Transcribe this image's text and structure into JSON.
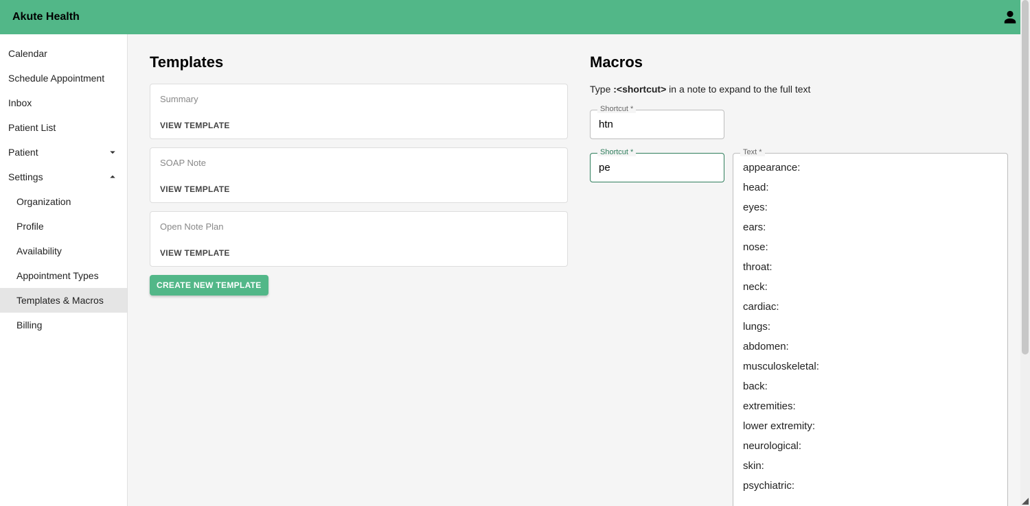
{
  "appbar": {
    "brand": "Akute Health"
  },
  "sidebar": {
    "items": [
      {
        "label": "Calendar",
        "expand": null
      },
      {
        "label": "Schedule Appointment",
        "expand": null
      },
      {
        "label": "Inbox",
        "expand": null
      },
      {
        "label": "Patient List",
        "expand": null
      },
      {
        "label": "Patient",
        "expand": "down"
      },
      {
        "label": "Settings",
        "expand": "up"
      }
    ],
    "settings_sub": [
      {
        "label": "Organization"
      },
      {
        "label": "Profile"
      },
      {
        "label": "Availability"
      },
      {
        "label": "Appointment Types"
      },
      {
        "label": "Templates & Macros",
        "active": true
      },
      {
        "label": "Billing"
      }
    ]
  },
  "templates": {
    "title": "Templates",
    "view_label": "VIEW TEMPLATE",
    "create_label": "CREATE NEW TEMPLATE",
    "items": [
      {
        "name": "Summary"
      },
      {
        "name": "SOAP Note"
      },
      {
        "name": "Open Note Plan"
      }
    ]
  },
  "macros": {
    "title": "Macros",
    "desc_prefix": "Type ",
    "desc_bold": ":<shortcut>",
    "desc_suffix": " in a note to expand to the full text",
    "shortcut_label": "Shortcut *",
    "text_label": "Text *",
    "rows": [
      {
        "shortcut": "htn"
      }
    ],
    "editing": {
      "shortcut": "pe",
      "text_lines": [
        "appearance:",
        "head:",
        "eyes:",
        "ears:",
        "nose:",
        "throat:",
        "neck:",
        "cardiac:",
        "lungs:",
        "abdomen:",
        "musculoskeletal:",
        "back:",
        "extremities:",
        "lower extremity:",
        "neurological:",
        "skin:",
        "psychiatric:"
      ]
    }
  }
}
